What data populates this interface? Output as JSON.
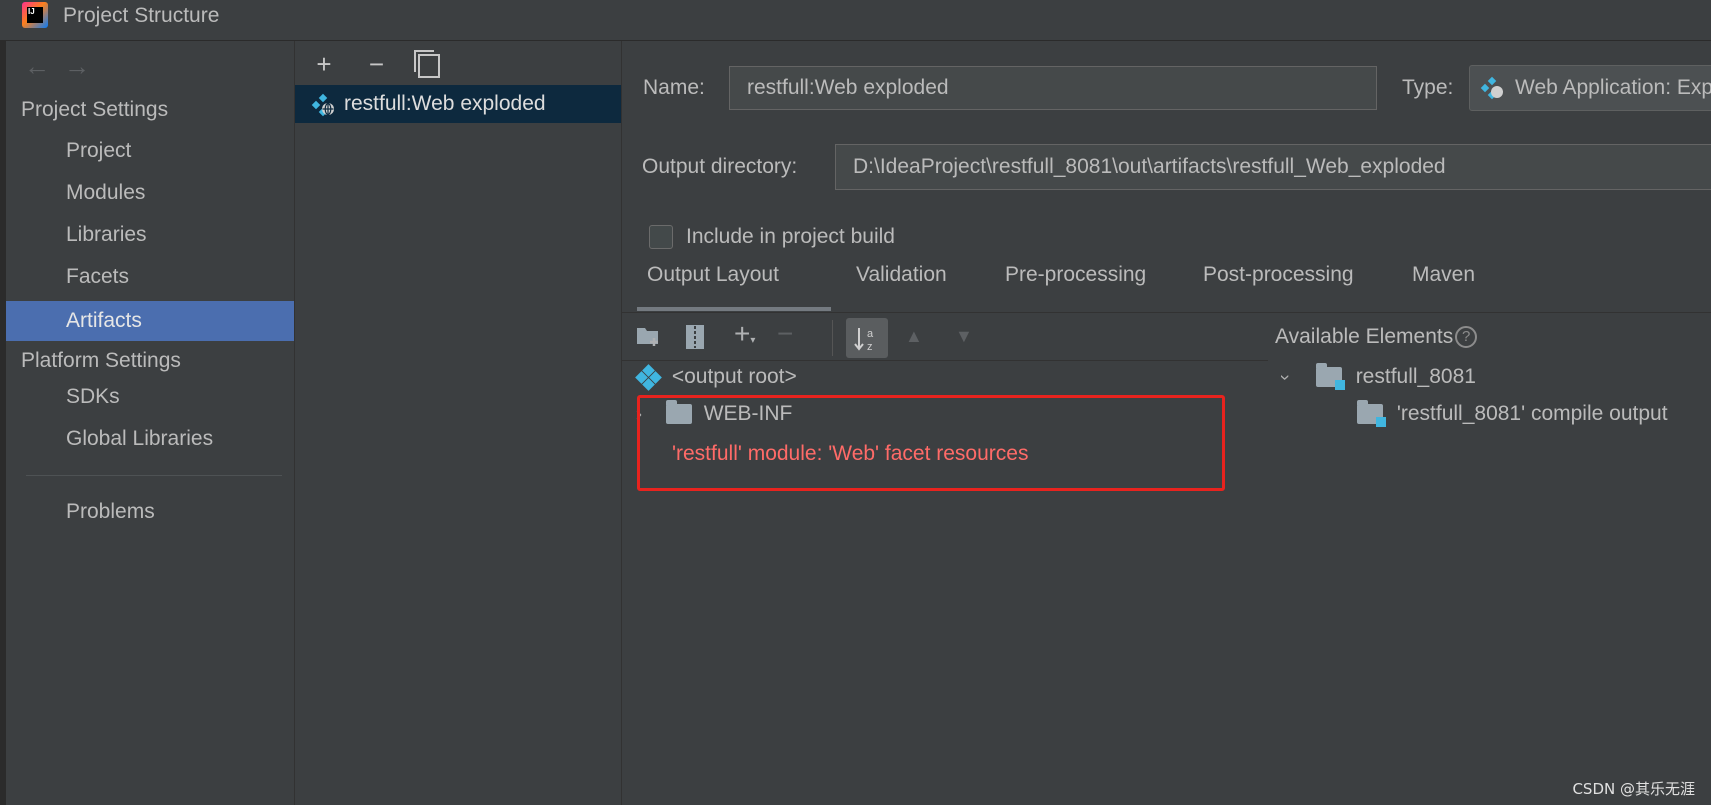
{
  "window": {
    "title": "Project Structure"
  },
  "sidebar": {
    "project_settings_title": "Project Settings",
    "project_items": [
      {
        "label": "Project"
      },
      {
        "label": "Modules"
      },
      {
        "label": "Libraries"
      },
      {
        "label": "Facets"
      },
      {
        "label": "Artifacts",
        "selected": true
      }
    ],
    "platform_settings_title": "Platform Settings",
    "platform_items": [
      {
        "label": "SDKs"
      },
      {
        "label": "Global Libraries"
      }
    ],
    "problems_label": "Problems"
  },
  "artifacts_list": {
    "toolbar": {
      "add_label": "+",
      "remove_label": "−"
    },
    "items": [
      {
        "label": "restfull:Web exploded",
        "icon": "web-artifact-icon"
      }
    ]
  },
  "editor": {
    "name_label": "Name:",
    "name_value": "restfull:Web exploded",
    "type_label": "Type:",
    "type_value": "Web Application: Exploded",
    "output_dir_label": "Output directory:",
    "output_dir_value": "D:\\IdeaProject\\restfull_8081\\out\\artifacts\\restfull_Web_exploded",
    "include_build_label": "Include in project build",
    "include_build_checked": false,
    "tabs": [
      {
        "label": "Output Layout",
        "active": true
      },
      {
        "label": "Validation"
      },
      {
        "label": "Pre-processing"
      },
      {
        "label": "Post-processing"
      },
      {
        "label": "Maven"
      }
    ],
    "layout_tree": {
      "root": "<output root>",
      "web_inf": "WEB-INF",
      "resources": "'restfull' module: 'Web' facet resources"
    },
    "available": {
      "title": "Available Elements",
      "module": "restfull_8081",
      "compile_output": "'restfull_8081' compile output"
    }
  },
  "watermark": "CSDN @其乐无涯",
  "colors": {
    "accent": "#4b6eaf",
    "error_text": "#ff6b68",
    "highlight_box": "#e8231e",
    "background": "#3c3f41"
  }
}
